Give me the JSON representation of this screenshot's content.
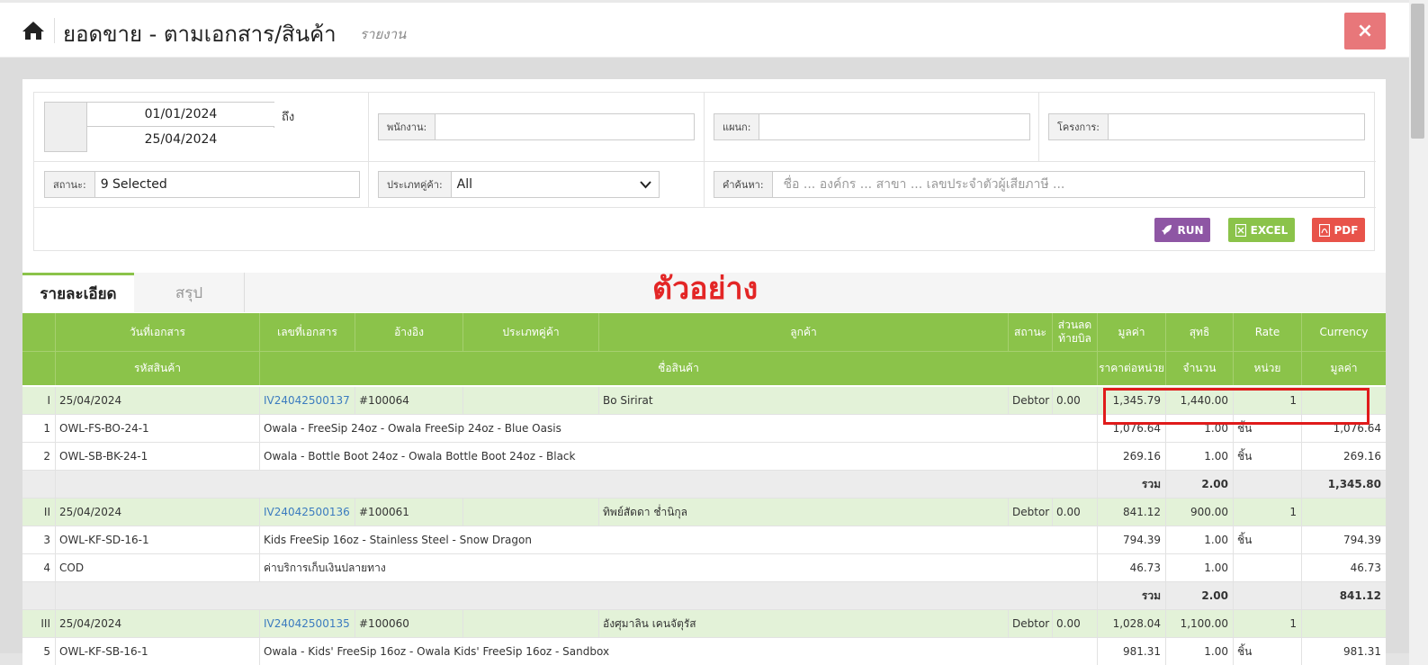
{
  "header": {
    "title": "ยอดขาย - ตามเอกสาร/สินค้า",
    "subtitle": "รายงาน",
    "close_label": "×"
  },
  "filters": {
    "date_from": "01/01/2024",
    "date_to": "25/04/2024",
    "date_to_label": "ถึง",
    "employee_label": "พนักงาน:",
    "employee_value": "",
    "department_label": "แผนก:",
    "department_value": "",
    "project_label": "โครงการ:",
    "project_value": "",
    "status_label": "สถานะ:",
    "status_value": "9 Selected",
    "customer_type_label": "ประเภทคู่ค้า:",
    "customer_type_value": "All",
    "search_label": "คำค้นหา:",
    "search_placeholder": "ชื่อ ... องค์กร ... สาขา ... เลขประจำตัวผู้เสียภาษี ..."
  },
  "buttons": {
    "run": "RUN",
    "excel": "EXCEL",
    "pdf": "PDF"
  },
  "tabs": {
    "detail": "รายละเอียด",
    "summary": "สรุป"
  },
  "watermark": "ตัวอย่าง",
  "table_header": {
    "row1": {
      "doc_date": "วันที่เอกสาร",
      "doc_no": "เลขที่เอกสาร",
      "reference": "อ้างอิง",
      "customer_type": "ประเภทคู่ค้า",
      "customer": "ลูกค้า",
      "status": "สถานะ",
      "end_discount": "ส่วนลด ท้ายบิล",
      "value": "มูลค่า",
      "net": "สุทธิ",
      "rate": "Rate",
      "currency": "Currency"
    },
    "row2": {
      "product_code": "รหัสสินค้า",
      "product_name": "ชื่อสินค้า",
      "unit_price": "ราคาต่อหน่วย",
      "quantity": "จำนวน",
      "unit": "หน่วย",
      "value": "มูลค่า"
    }
  },
  "rows": {
    "d1": {
      "no": "I",
      "date": "25/04/2024",
      "doc": "IV24042500137",
      "ref": "#100064",
      "ctype": "",
      "customer": "Bo Sirirat",
      "status": "Debtor",
      "disc": "0.00",
      "value": "1,345.79",
      "net": "1,440.00",
      "rate": "1",
      "currency": ""
    },
    "i1": {
      "no": "1",
      "code": "OWL-FS-BO-24-1",
      "name": "Owala - FreeSip 24oz - Owala FreeSip 24oz - Blue Oasis",
      "price": "1,076.64",
      "qty": "1.00",
      "unit": "ชิ้น",
      "value": "1,076.64"
    },
    "i2": {
      "no": "2",
      "code": "OWL-SB-BK-24-1",
      "name": "Owala - Bottle Boot 24oz - Owala Bottle Boot 24oz - Black",
      "price": "269.16",
      "qty": "1.00",
      "unit": "ชิ้น",
      "value": "269.16"
    },
    "t1": {
      "label": "รวม",
      "qty": "2.00",
      "value": "1,345.80"
    },
    "d2": {
      "no": "II",
      "date": "25/04/2024",
      "doc": "IV24042500136",
      "ref": "#100061",
      "ctype": "",
      "customer": "ทิพย์สัดดา ช่ำนิกุล",
      "status": "Debtor",
      "disc": "0.00",
      "value": "841.12",
      "net": "900.00",
      "rate": "1",
      "currency": ""
    },
    "i3": {
      "no": "3",
      "code": "OWL-KF-SD-16-1",
      "name": "Kids FreeSip 16oz - Stainless Steel - Snow Dragon",
      "price": "794.39",
      "qty": "1.00",
      "unit": "ชิ้น",
      "value": "794.39"
    },
    "i4": {
      "no": "4",
      "code": "COD",
      "name": "ค่าบริการเก็บเงินปลายทาง",
      "price": "46.73",
      "qty": "1.00",
      "unit": "",
      "value": "46.73"
    },
    "t2": {
      "label": "รวม",
      "qty": "2.00",
      "value": "841.12"
    },
    "d3": {
      "no": "III",
      "date": "25/04/2024",
      "doc": "IV24042500135",
      "ref": "#100060",
      "ctype": "",
      "customer": "อังศุมาลิน เคนจัตุรัส",
      "status": "Debtor",
      "disc": "0.00",
      "value": "1,028.04",
      "net": "1,100.00",
      "rate": "1",
      "currency": ""
    },
    "i5": {
      "no": "5",
      "code": "OWL-KF-SB-16-1",
      "name": "Owala - Kids' FreeSip 16oz - Owala Kids' FreeSip 16oz - Sandbox",
      "price": "981.31",
      "qty": "1.00",
      "unit": "ชิ้น",
      "value": "981.31"
    }
  },
  "colors": {
    "table_header_green": "#8bc34a",
    "doc_row_green": "#e3f2d8",
    "run_purple": "#8e56a4",
    "excel_green": "#8bc34a",
    "pdf_red": "#e8534a",
    "close_red": "#e8777a",
    "link_blue": "#3b7bbf",
    "watermark_red": "#e32626"
  },
  "icons": {
    "home": "home-icon",
    "close": "close-icon",
    "run": "rocket-icon",
    "excel": "excel-file-icon",
    "pdf": "pdf-file-icon",
    "dropdown": "chevron-down-icon"
  }
}
